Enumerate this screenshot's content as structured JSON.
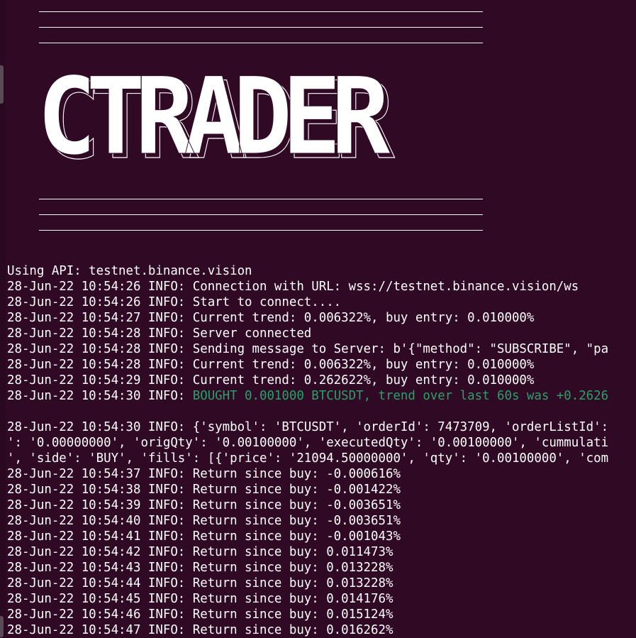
{
  "banner": {
    "title": "CTRADER",
    "rule": "_________________________________________________________"
  },
  "log_lines": [
    {
      "text": "Using API: testnet.binance.vision"
    },
    {
      "text": "28-Jun-22 10:54:26 INFO: Connection with URL: wss://testnet.binance.vision/ws"
    },
    {
      "text": "28-Jun-22 10:54:26 INFO: Start to connect...."
    },
    {
      "text": "28-Jun-22 10:54:27 INFO: Current trend: 0.006322%, buy entry: 0.010000%"
    },
    {
      "text": "28-Jun-22 10:54:28 INFO: Server connected"
    },
    {
      "text": "28-Jun-22 10:54:28 INFO: Sending message to Server: b'{\"method\": \"SUBSCRIBE\", \"pa"
    },
    {
      "text": "28-Jun-22 10:54:28 INFO: Current trend: 0.006322%, buy entry: 0.010000%"
    },
    {
      "text": "28-Jun-22 10:54:29 INFO: Current trend: 0.262622%, buy entry: 0.010000%"
    },
    {
      "prefix": "28-Jun-22 10:54:30 INFO: ",
      "highlight": "BOUGHT 0.001000 BTCUSDT, trend over last 60s was +0.2626",
      "highlight_color": "#26a269"
    },
    {
      "text": ""
    },
    {
      "text": "28-Jun-22 10:54:30 INFO: {'symbol': 'BTCUSDT', 'orderId': 7473709, 'orderListId':"
    },
    {
      "text": "': '0.00000000', 'origQty': '0.00100000', 'executedQty': '0.00100000', 'cummulati"
    },
    {
      "text": "', 'side': 'BUY', 'fills': [{'price': '21094.50000000', 'qty': '0.00100000', 'com"
    },
    {
      "text": "28-Jun-22 10:54:37 INFO: Return since buy: -0.000616%"
    },
    {
      "text": "28-Jun-22 10:54:38 INFO: Return since buy: -0.001422%"
    },
    {
      "text": "28-Jun-22 10:54:39 INFO: Return since buy: -0.003651%"
    },
    {
      "text": "28-Jun-22 10:54:40 INFO: Return since buy: -0.003651%"
    },
    {
      "text": "28-Jun-22 10:54:41 INFO: Return since buy: -0.001043%"
    },
    {
      "text": "28-Jun-22 10:54:42 INFO: Return since buy: 0.011473%"
    },
    {
      "text": "28-Jun-22 10:54:43 INFO: Return since buy: 0.013228%"
    },
    {
      "text": "28-Jun-22 10:54:44 INFO: Return since buy: 0.013228%"
    },
    {
      "text": "28-Jun-22 10:54:45 INFO: Return since buy: 0.014176%"
    },
    {
      "text": "28-Jun-22 10:54:46 INFO: Return since buy: 0.015124%"
    },
    {
      "text": "28-Jun-22 10:54:47 INFO: Return since buy: 0.016262%"
    }
  ],
  "colors": {
    "background": "#300a24",
    "text": "#ffffff",
    "success": "#26a269"
  }
}
